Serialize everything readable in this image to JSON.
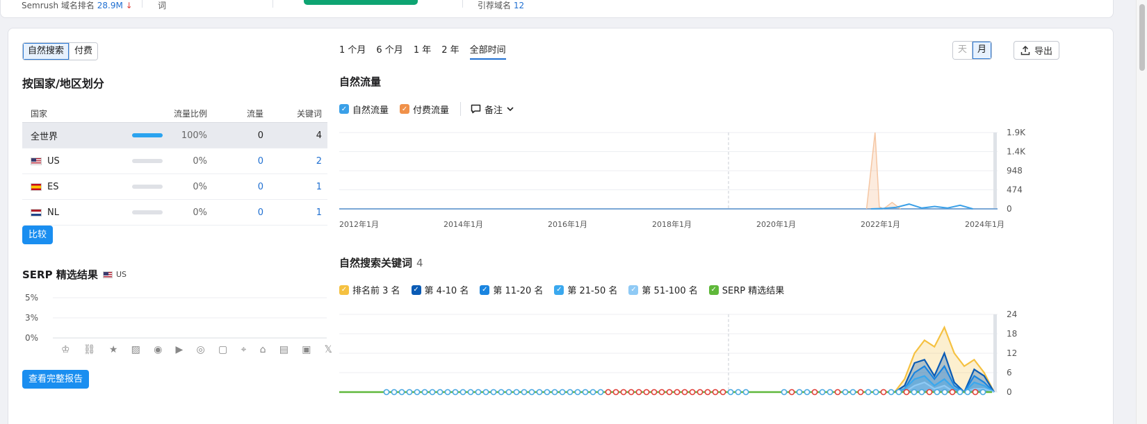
{
  "top": {
    "rank_label": "Semrush 域名排名",
    "rank_value": "28.9M",
    "rank_trend": "↓",
    "col2_text": "词",
    "col4_label": "引荐域名",
    "col4_value": "12"
  },
  "toggle": {
    "organic": "自然搜索",
    "paid": "付费"
  },
  "country_section": {
    "title": "按国家/地区划分",
    "headers": {
      "country": "国家",
      "share": "流量比例",
      "traffic": "流量",
      "keywords": "关键词"
    },
    "rows": [
      {
        "country": "全世界",
        "flag": "globe",
        "share_pct": 100,
        "share": "100%",
        "traffic": "0",
        "keywords": "4",
        "selected": true
      },
      {
        "country": "US",
        "flag": "us",
        "share_pct": 0,
        "share": "0%",
        "traffic": "0",
        "keywords": "2"
      },
      {
        "country": "ES",
        "flag": "es",
        "share_pct": 0,
        "share": "0%",
        "traffic": "0",
        "keywords": "1"
      },
      {
        "country": "NL",
        "flag": "nl",
        "share_pct": 0,
        "share": "0%",
        "traffic": "0",
        "keywords": "1"
      }
    ],
    "compare_button": "比较"
  },
  "serp_section": {
    "title": "SERP 精选结果",
    "country": "US",
    "y_ticks": [
      "5%",
      "3%",
      "0%"
    ],
    "icons": [
      "crown-icon",
      "link-icon",
      "star-icon",
      "image-icon",
      "video-icon",
      "play-icon",
      "video2-icon",
      "review-icon",
      "location-icon",
      "academic-icon",
      "news-icon",
      "briefcase-icon",
      "x-icon"
    ],
    "full_report_button": "查看完整报告"
  },
  "time_tabs": [
    "1 个月",
    "6 个月",
    "1 年",
    "2 年",
    "全部时间"
  ],
  "active_time_tab": 4,
  "granularity": {
    "day": "天",
    "month": "月",
    "active": "month"
  },
  "export_label": "导出",
  "traffic_chart": {
    "title": "自然流量",
    "legend": [
      {
        "label": "自然流量",
        "color": "#3aa0e8"
      },
      {
        "label": "付费流量",
        "color": "#f0914a"
      }
    ],
    "notes_label": "备注",
    "chart_data": {
      "type": "line",
      "y_ticks": [
        "1.9K",
        "1.4K",
        "948",
        "474",
        "0"
      ],
      "x_ticks": [
        "2012年1月",
        "2014年1月",
        "2016年1月",
        "2018年1月",
        "2020年1月",
        "2022年1月",
        "2024年1月"
      ],
      "ylim": [
        0,
        1900
      ],
      "series": [
        {
          "name": "自然流量",
          "color": "#3aa0e8",
          "x": [
            "2022-06",
            "2022-09",
            "2022-12",
            "2023-03",
            "2023-06",
            "2023-09",
            "2023-12",
            "2024-03",
            "2024-06"
          ],
          "values": [
            0,
            10,
            40,
            120,
            20,
            60,
            20,
            90,
            0
          ]
        },
        {
          "name": "付费流量",
          "color": "#f0914a",
          "x": [
            "2022-05",
            "2022-07",
            "2022-08",
            "2022-09",
            "2022-11",
            "2023-01"
          ],
          "values": [
            0,
            1900,
            50,
            0,
            160,
            0
          ]
        }
      ]
    }
  },
  "keywords_chart": {
    "title": "自然搜索关键词",
    "count": "4",
    "legend": [
      {
        "label": "排名前 3 名",
        "color": "#f5c141"
      },
      {
        "label": "第 4-10 名",
        "color": "#0a5bb5"
      },
      {
        "label": "第 11-20 名",
        "color": "#1a85e0"
      },
      {
        "label": "第 21-50 名",
        "color": "#3aa8ee"
      },
      {
        "label": "第 51-100 名",
        "color": "#8fcaf5"
      },
      {
        "label": "SERP 精选结果",
        "color": "#5fb83a"
      }
    ],
    "chart_data": {
      "type": "area",
      "y_ticks": [
        "24",
        "18",
        "12",
        "6",
        "0"
      ],
      "ylim": [
        0,
        24
      ],
      "series": [
        {
          "name": "排名前 3 名",
          "color": "#f5c141",
          "values": [
            0,
            4,
            12,
            16,
            14,
            20,
            12,
            8,
            10,
            6,
            0
          ]
        },
        {
          "name": "第 4-10 名",
          "color": "#0a5bb5",
          "values": [
            0,
            2,
            9,
            10,
            5,
            12,
            3,
            0,
            7,
            5,
            0
          ]
        },
        {
          "name": "第 11-20 名",
          "color": "#1a85e0",
          "values": [
            0,
            1,
            6,
            8,
            4,
            8,
            2,
            0,
            5,
            3,
            0
          ]
        },
        {
          "name": "第 21-50 名",
          "color": "#3aa8ee",
          "values": [
            0,
            1,
            4,
            5,
            2,
            4,
            1,
            0,
            3,
            2,
            0
          ]
        },
        {
          "name": "第 51-100 名",
          "color": "#8fcaf5",
          "values": [
            0,
            0,
            2,
            3,
            1,
            2,
            0,
            0,
            1,
            1,
            0
          ]
        }
      ]
    }
  }
}
